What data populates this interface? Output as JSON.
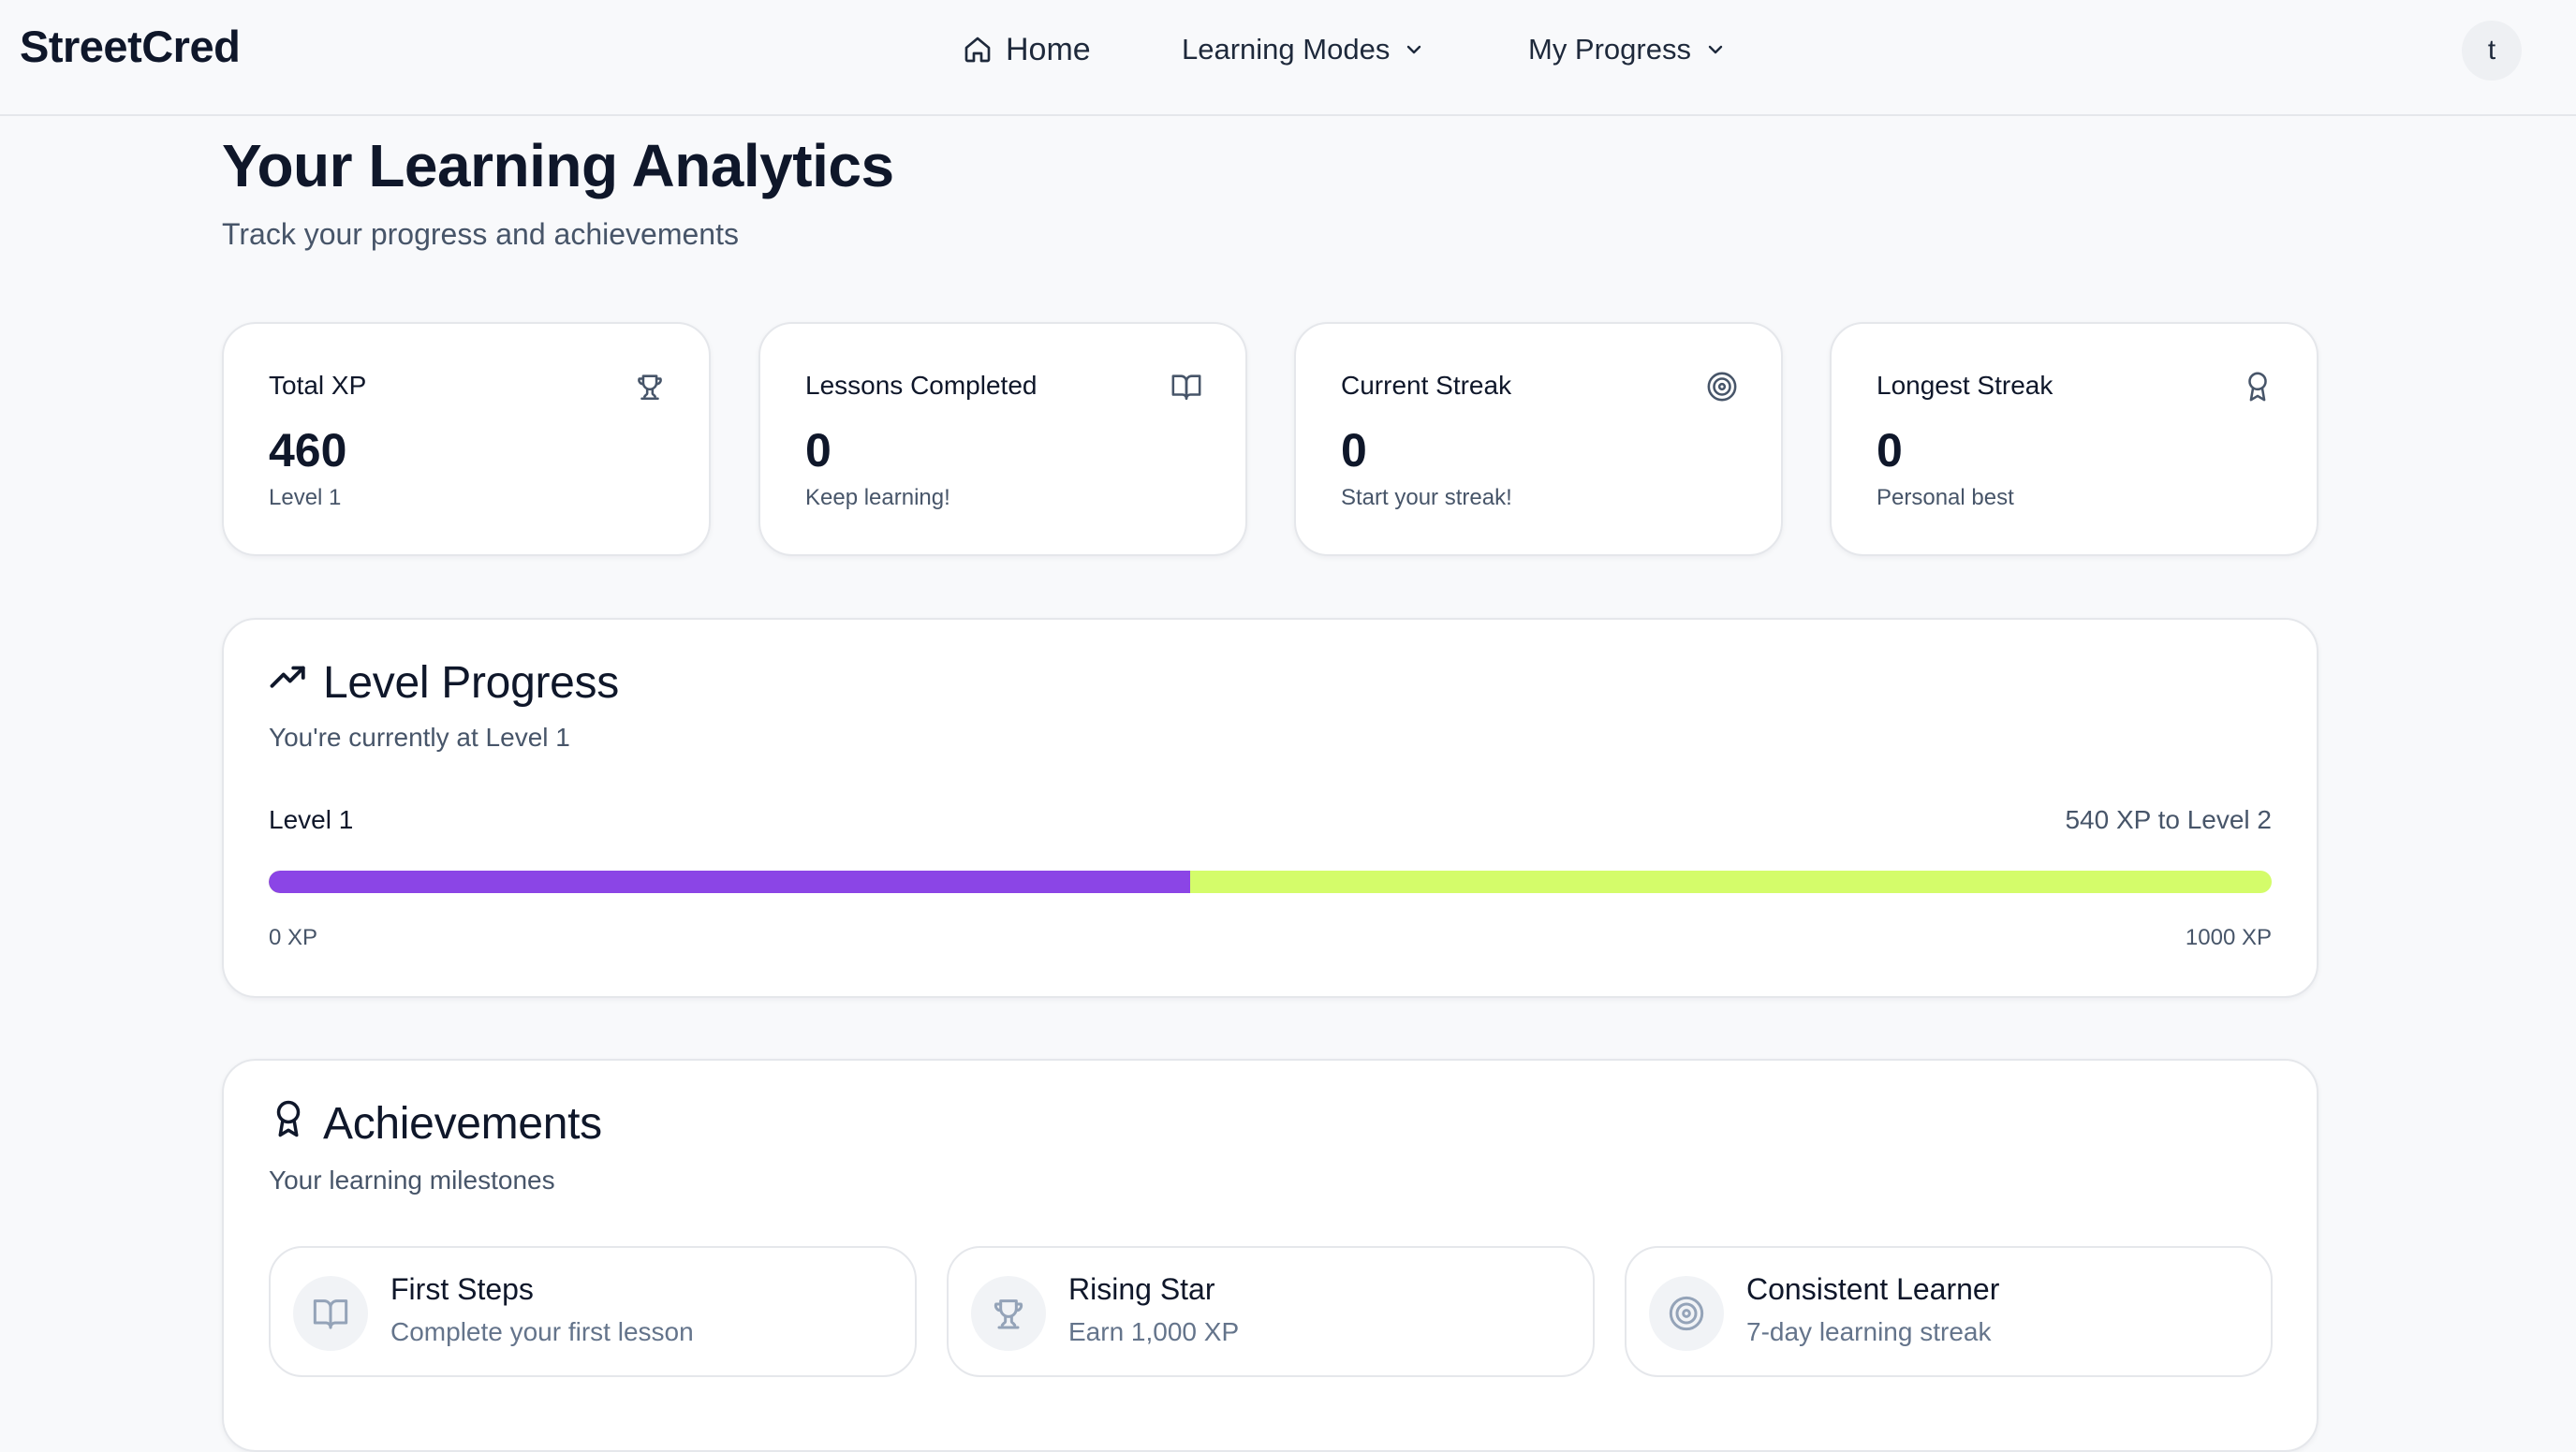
{
  "nav": {
    "brand": "StreetCred",
    "home_label": "Home",
    "learning_modes_label": "Learning Modes",
    "my_progress_label": "My Progress",
    "avatar_initial": "t"
  },
  "header": {
    "title": "Your Learning Analytics",
    "subtitle": "Track your progress and achievements"
  },
  "stats": [
    {
      "label": "Total XP",
      "value": "460",
      "caption": "Level 1",
      "icon": "trophy-icon"
    },
    {
      "label": "Lessons Completed",
      "value": "0",
      "caption": "Keep learning!",
      "icon": "book-icon"
    },
    {
      "label": "Current Streak",
      "value": "0",
      "caption": "Start your streak!",
      "icon": "target-icon"
    },
    {
      "label": "Longest Streak",
      "value": "0",
      "caption": "Personal best",
      "icon": "award-icon"
    }
  ],
  "level_progress": {
    "title": "Level Progress",
    "subtitle": "You're currently at Level 1",
    "current_level_label": "Level 1",
    "remaining_label": "540 XP to Level 2",
    "min_label": "0 XP",
    "max_label": "1000 XP",
    "progress_fraction": 0.46,
    "fill_color": "#8b45e6",
    "track_color": "#d4fc6a"
  },
  "achievements": {
    "title": "Achievements",
    "subtitle": "Your learning milestones",
    "items": [
      {
        "title": "First Steps",
        "description": "Complete your first lesson",
        "icon": "book-icon"
      },
      {
        "title": "Rising Star",
        "description": "Earn 1,000 XP",
        "icon": "trophy-icon"
      },
      {
        "title": "Consistent Learner",
        "description": "7-day learning streak",
        "icon": "target-icon"
      }
    ]
  }
}
